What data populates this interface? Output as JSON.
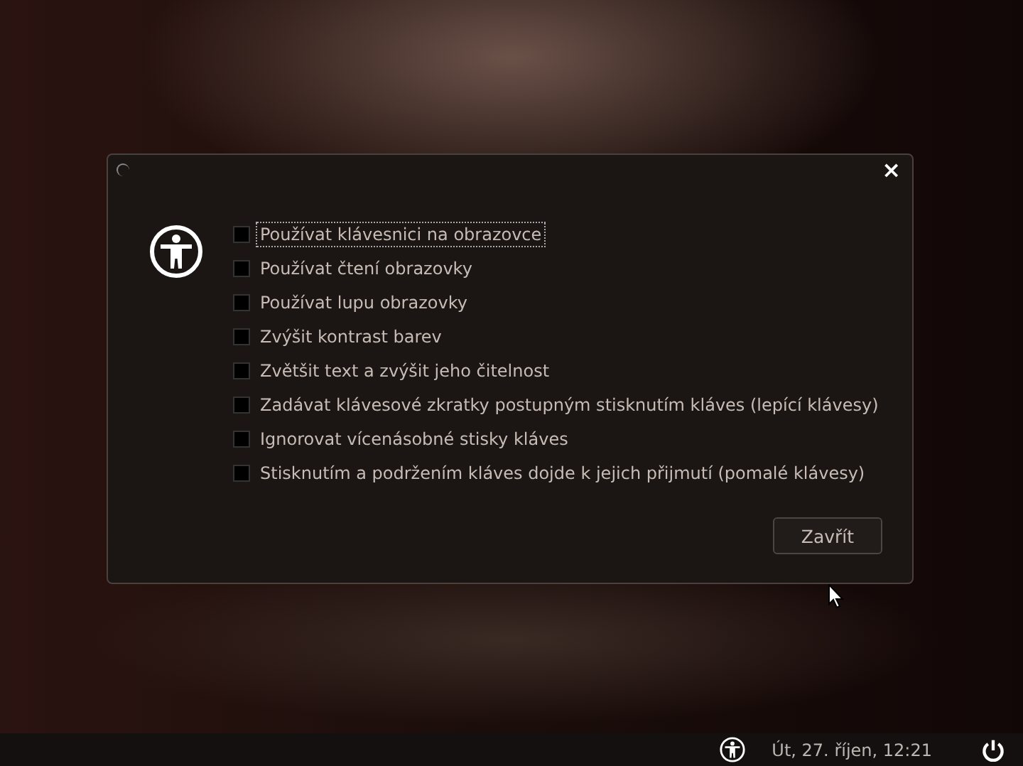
{
  "dialog": {
    "close_button": "×",
    "options": [
      {
        "label": "Používat klávesnici na obrazovce",
        "checked": false,
        "focused": true
      },
      {
        "label": "Používat čtení obrazovky",
        "checked": false,
        "focused": false
      },
      {
        "label": "Používat lupu obrazovky",
        "checked": false,
        "focused": false
      },
      {
        "label": "Zvýšit kontrast barev",
        "checked": false,
        "focused": false
      },
      {
        "label": "Zvětšit text a zvýšit jeho čitelnost",
        "checked": false,
        "focused": false
      },
      {
        "label": "Zadávat klávesové zkratky postupným stisknutím kláves (lepící klávesy)",
        "checked": false,
        "focused": false
      },
      {
        "label": "Ignorovat vícenásobné stisky kláves",
        "checked": false,
        "focused": false
      },
      {
        "label": "Stisknutím a podržením kláves dojde k jejich přijmutí (pomalé klávesy)",
        "checked": false,
        "focused": false
      }
    ],
    "button": "Zavřít"
  },
  "panel": {
    "clock": "Út, 27. říjen, 12:21"
  }
}
